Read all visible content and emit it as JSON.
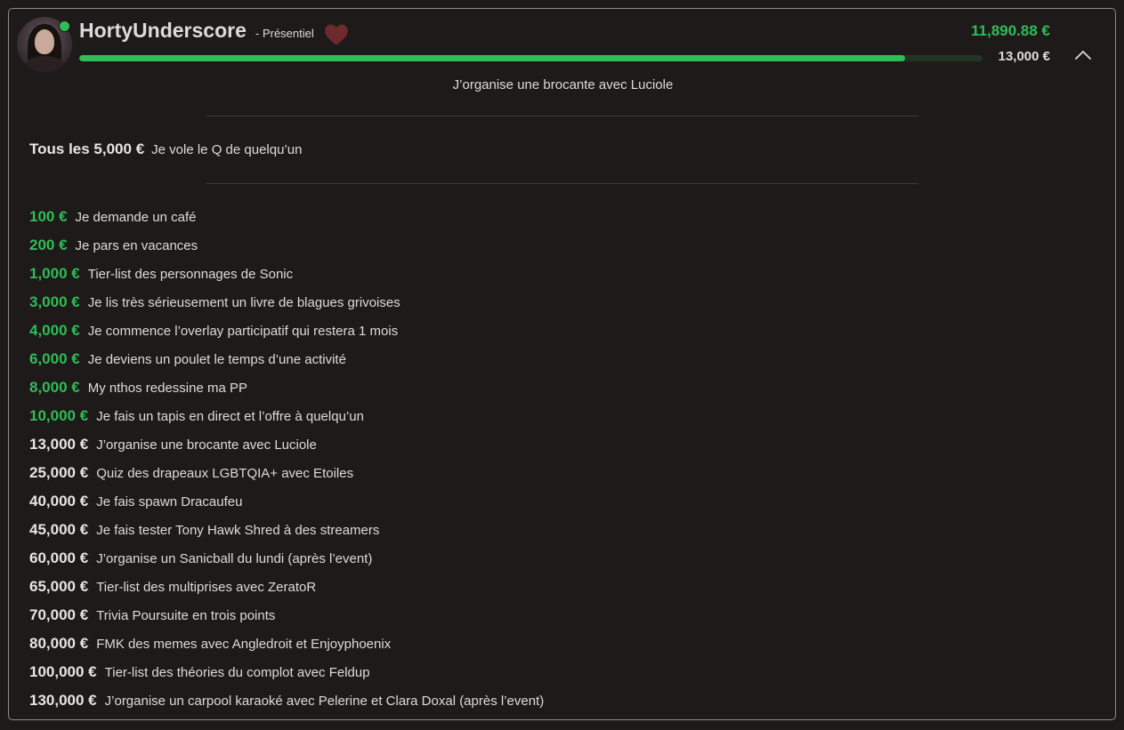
{
  "user": {
    "name": "HortyUnderscore",
    "mode": "- Présentiel",
    "online": true
  },
  "progress": {
    "current": "11,890.88 €",
    "goal": "13,000 €",
    "fraction": 0.9147,
    "next_goal_text": "J’organise une brocante avec Luciole"
  },
  "recurring": {
    "label": "Tous les 5,000 €",
    "text": "Je vole le Q de quelqu’un"
  },
  "colors": {
    "reached": "#2ebd57",
    "pending": "#e6e6e6",
    "heart": "#6e2a2c"
  },
  "icons": {
    "favorite": "heart-icon",
    "collapse": "chevron-up-icon"
  },
  "goals": [
    {
      "amount": "100 €",
      "text": "Je demande un café",
      "reached": true
    },
    {
      "amount": "200 €",
      "text": "Je pars en vacances",
      "reached": true
    },
    {
      "amount": "1,000 €",
      "text": "Tier-list des personnages de Sonic",
      "reached": true
    },
    {
      "amount": "3,000 €",
      "text": "Je lis très sérieusement un livre de blagues grivoises",
      "reached": true
    },
    {
      "amount": "4,000 €",
      "text": "Je commence l’overlay participatif qui restera 1 mois",
      "reached": true
    },
    {
      "amount": "6,000 €",
      "text": "Je deviens un poulet le temps d’une activité",
      "reached": true
    },
    {
      "amount": "8,000 €",
      "text": "My nthos redessine ma PP",
      "reached": true
    },
    {
      "amount": "10,000 €",
      "text": "Je fais un tapis en direct et l’offre à quelqu’un",
      "reached": true
    },
    {
      "amount": "13,000 €",
      "text": "J’organise une brocante avec Luciole",
      "reached": false
    },
    {
      "amount": "25,000 €",
      "text": "Quiz des drapeaux LGBTQIA+ avec Etoiles",
      "reached": false
    },
    {
      "amount": "40,000 €",
      "text": "Je fais spawn Dracaufeu",
      "reached": false
    },
    {
      "amount": "45,000 €",
      "text": "Je fais tester Tony Hawk Shred à des streamers",
      "reached": false
    },
    {
      "amount": "60,000 €",
      "text": "J’organise un Sanicball du lundi (après l’event)",
      "reached": false
    },
    {
      "amount": "65,000 €",
      "text": "Tier-list des multiprises avec ZeratoR",
      "reached": false
    },
    {
      "amount": "70,000 €",
      "text": "Trivia Poursuite en trois points",
      "reached": false
    },
    {
      "amount": "80,000 €",
      "text": "FMK des memes avec Angledroit et Enjoyphoenix",
      "reached": false
    },
    {
      "amount": "100,000 €",
      "text": "Tier-list des théories du complot avec Feldup",
      "reached": false
    },
    {
      "amount": "130,000 €",
      "text": "J’organise un carpool karaoké avec Pelerine et Clara Doxal (après l’event)",
      "reached": false
    }
  ]
}
